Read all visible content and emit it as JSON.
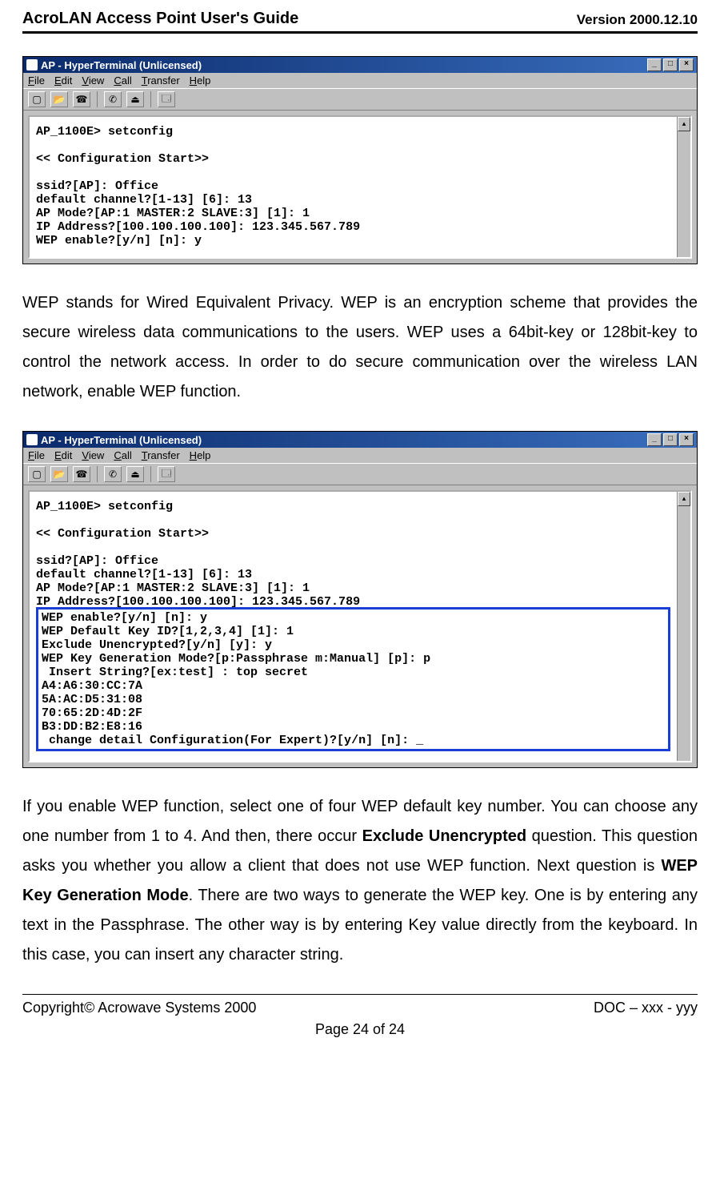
{
  "header": {
    "title": "AcroLAN Access Point User's Guide",
    "version": "Version 2000.12.10"
  },
  "footer": {
    "copyright": "Copyright© Acrowave Systems 2000",
    "doc_id": "DOC – xxx - yyy",
    "page": "Page 24 of 24"
  },
  "ht_window": {
    "title": "AP - HyperTerminal (Unlicensed)",
    "menus": {
      "file": "File",
      "edit": "Edit",
      "view": "View",
      "call": "Call",
      "transfer": "Transfer",
      "help": "Help"
    }
  },
  "terminal1": {
    "text": "AP_1100E> setconfig\n\n<< Configuration Start>>\n\nssid?[AP]: Office\ndefault channel?[1-13] [6]: 13\nAP Mode?[AP:1 MASTER:2 SLAVE:3] [1]: 1\nIP Address?[100.100.100.100]: 123.345.567.789\nWEP enable?[y/n] [n]: y"
  },
  "para1_text": "WEP stands for Wired Equivalent Privacy. WEP is an encryption scheme that provides the secure wireless data communications to the users. WEP uses a 64bit-key or 128bit-key to control the network access. In order to do secure communication over the wireless LAN network, enable WEP function.",
  "terminal2": {
    "pre_text": "AP_1100E> setconfig\n\n<< Configuration Start>>\n\nssid?[AP]: Office\ndefault channel?[1-13] [6]: 13\nAP Mode?[AP:1 MASTER:2 SLAVE:3] [1]: 1\nIP Address?[100.100.100.100]: 123.345.567.789",
    "hl_text": "WEP enable?[y/n] [n]: y\nWEP Default Key ID?[1,2,3,4] [1]: 1\nExclude Unencrypted?[y/n] [y]: y\nWEP Key Generation Mode?[p:Passphrase m:Manual] [p]: p\n Insert String?[ex:test] : top secret\nA4:A6:30:CC:7A\n5A:AC:D5:31:08\n70:65:2D:4D:2F\nB3:DD:B2:E8:16\n change detail Configuration(For Expert)?[y/n] [n]: _"
  },
  "para2": {
    "t1": "If you enable WEP function, select one of four WEP default key number. You can choose any one number from 1 to 4. And then, there occur ",
    "b1": "Exclude Unencrypted",
    "t2": " question. This question asks you whether you allow a client that does not use WEP function. Next question is ",
    "b2": "WEP Key Generation Mode",
    "t3": ". There are two ways to generate the WEP key. One is by entering any text in the Passphrase. The other way is by entering Key value directly from the keyboard. In this case, you can insert any character string."
  }
}
